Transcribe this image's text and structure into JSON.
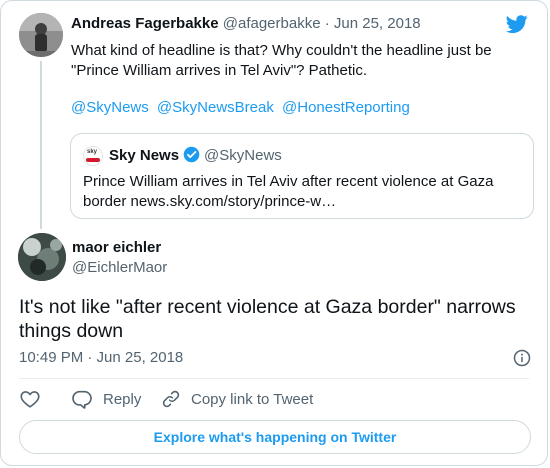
{
  "brand": {
    "accent_color": "#1d9bf0",
    "logo_icon": "twitter-bird-icon"
  },
  "parent_tweet": {
    "author_name": "Andreas Fagerbakke",
    "author_handle": "@afagerbakke",
    "separator": "·",
    "date": "Jun 25, 2018",
    "text": "What kind of headline is that? Why couldn't the headline just be \"Prince William arrives in Tel Aviv\"? Pathetic.",
    "mentions": [
      "@SkyNews",
      "@SkyNewsBreak",
      "@HonestReporting"
    ],
    "quoted": {
      "author_name": "Sky News",
      "author_handle": "@SkyNews",
      "verified_icon": "verified-badge-icon",
      "text": "Prince William arrives in Tel Aviv after recent violence at Gaza border news.sky.com/story/prince-w…"
    }
  },
  "main_tweet": {
    "author_name": "maor eichler",
    "author_handle": "@EichlerMaor",
    "text": "It's not like \"after recent violence at Gaza border\" narrows things down",
    "timestamp": "10:49 PM · Jun 25, 2018"
  },
  "actions": {
    "like_icon": "heart-icon",
    "reply_label": "Reply",
    "copy_link_label": "Copy link to Tweet"
  },
  "explore_label": "Explore what's happening on Twitter"
}
